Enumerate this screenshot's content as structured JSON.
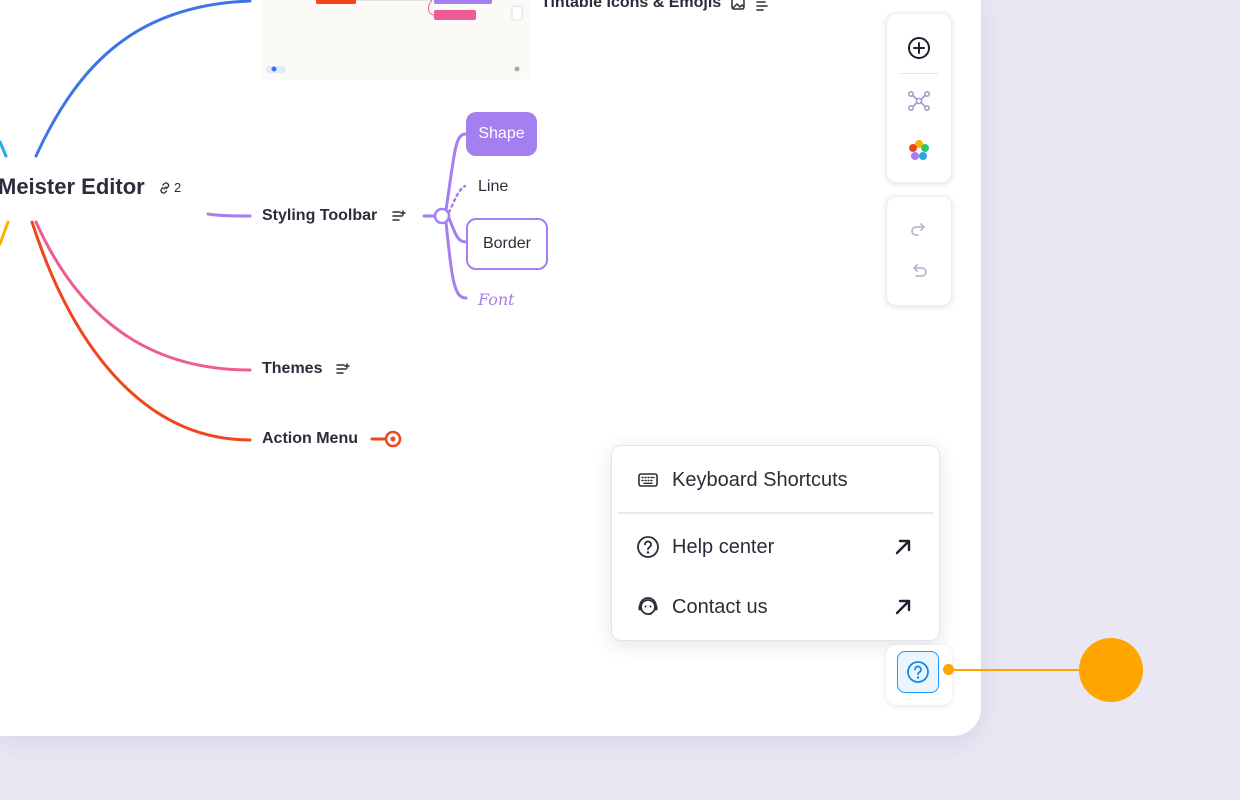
{
  "mindmap": {
    "root": {
      "label": "Meister Editor",
      "link_count": "2"
    },
    "top_node": {
      "label": "Tintable Icons & Emojis"
    },
    "styling_toolbar": {
      "label": "Styling Toolbar",
      "children": [
        "Shape",
        "Line",
        "Border",
        "Font"
      ]
    },
    "themes": {
      "label": "Themes"
    },
    "action_menu": {
      "label": "Action Menu"
    },
    "colors": {
      "blue": "#3e74ea",
      "purple": "#a47ff0",
      "pink": "#ee5b95",
      "red": "#f0461e",
      "yellow": "#f7b500",
      "cyan": "#23a9e6"
    }
  },
  "toolbar": {
    "add_icon": "plus-circle-icon",
    "layout_icon": "mindmap-layout-icon",
    "color_icon": "color-palette-icon",
    "redo_icon": "redo-icon",
    "undo_icon": "undo-icon"
  },
  "help_menu": {
    "items": [
      {
        "label": "Keyboard Shortcuts",
        "icon": "keyboard-icon"
      },
      {
        "label": "Help center",
        "icon": "question-circle-icon",
        "external": true
      },
      {
        "label": "Contact us",
        "icon": "support-agent-icon",
        "external": true
      }
    ]
  },
  "help_button": {
    "icon": "question-circle-icon"
  },
  "callout": {
    "color": "#ffa500"
  }
}
